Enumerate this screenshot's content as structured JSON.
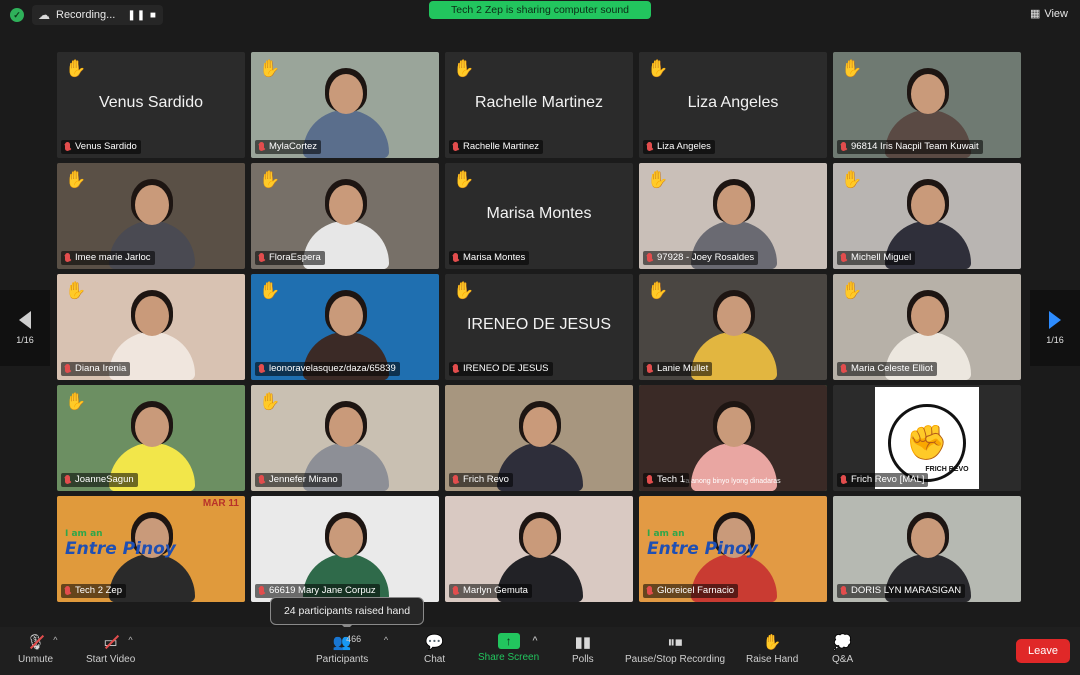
{
  "topbar": {
    "recording_label": "Recording...",
    "recording_controls": "❚❚ ■",
    "share_banner": "Tech 2 Zep is sharing computer sound",
    "view_label": "View"
  },
  "pager": {
    "left": "1/16",
    "right": "1/16"
  },
  "tiles": [
    {
      "name": "Venus Sardido",
      "center": "Venus Sardido",
      "hand": true,
      "video": false
    },
    {
      "name": "MylaCortez",
      "center": "",
      "hand": true,
      "video": true,
      "bg": "#9aa59a",
      "shirt": "#5a6e8c"
    },
    {
      "name": "Rachelle Martinez",
      "center": "Rachelle Martinez",
      "hand": true,
      "video": false
    },
    {
      "name": "Liza Angeles",
      "center": "Liza Angeles",
      "hand": true,
      "video": false
    },
    {
      "name": "96814 Iris Nacpil Team Kuwait",
      "center": "",
      "hand": true,
      "video": true,
      "bg": "#6f7a72",
      "shirt": "#5a4a44"
    },
    {
      "name": "Imee marie Jarloc",
      "center": "",
      "hand": true,
      "video": true,
      "bg": "#5a5046",
      "shirt": "#4a4a52"
    },
    {
      "name": "FloraEspera",
      "center": "",
      "hand": true,
      "video": true,
      "bg": "#777068",
      "shirt": "#e7e7e7"
    },
    {
      "name": "Marisa Montes",
      "center": "Marisa Montes",
      "hand": true,
      "video": false
    },
    {
      "name": "97928 - Joey Rosaldes",
      "center": "",
      "hand": true,
      "video": true,
      "bg": "#c9bfb8",
      "shirt": "#6a6a72"
    },
    {
      "name": "Michell Miguel",
      "center": "",
      "hand": true,
      "video": true,
      "bg": "#b9b5b2",
      "shirt": "#2f2f3a"
    },
    {
      "name": "Diana Irenia",
      "center": "",
      "hand": true,
      "video": true,
      "bg": "#d8c2b2",
      "shirt": "#f0e6de"
    },
    {
      "name": "leonoravelasquez/daza/65839",
      "center": "",
      "hand": true,
      "video": true,
      "bg": "#1f6fb0",
      "shirt": "#3b2a26"
    },
    {
      "name": "IRENEO DE JESUS",
      "center": "IRENEO DE JESUS",
      "hand": true,
      "video": false
    },
    {
      "name": "Lanie Mullet",
      "center": "",
      "hand": true,
      "video": true,
      "bg": "#4a4642",
      "shirt": "#e2b640"
    },
    {
      "name": "Maria Celeste Elliot",
      "center": "",
      "hand": true,
      "video": true,
      "bg": "#b7b1a8",
      "shirt": "#ece7df"
    },
    {
      "name": "JoanneSagun",
      "center": "",
      "hand": true,
      "video": true,
      "bg": "#6c8f62",
      "shirt": "#f2e64a"
    },
    {
      "name": "Jennefer Mirano",
      "center": "",
      "hand": true,
      "video": true,
      "bg": "#c9c0b2",
      "shirt": "#8d8f96"
    },
    {
      "name": "Frich Revo",
      "center": "",
      "hand": false,
      "video": true,
      "bg": "#a7967f",
      "shirt": "#2e2e3a"
    },
    {
      "name": "Tech 1",
      "center": "",
      "hand": false,
      "video": true,
      "bg": "#3a2a26",
      "shirt": "#e9a6a2",
      "caption": "ra anong binyo lyong dinadaras",
      "active": true
    },
    {
      "name": "Frich Revo [MAL]",
      "center": "",
      "hand": false,
      "video": false,
      "logo": true,
      "logo_text": "FRICH REVO"
    },
    {
      "name": "Tech 2 Zep",
      "center": "",
      "hand": false,
      "video": true,
      "bg": "#e09a3c",
      "shirt": "#2a2a2a",
      "banner": "MAR 11",
      "promo_small": "I am an",
      "promo_big": "Entre Pinoy"
    },
    {
      "name": "66619 Mary Jane Corpuz",
      "center": "",
      "hand": false,
      "video": true,
      "bg": "#eaeaea",
      "shirt": "#2f6a4a"
    },
    {
      "name": "Marlyn Gemuta",
      "center": "",
      "hand": false,
      "video": true,
      "bg": "#d9c9c2",
      "shirt": "#222226"
    },
    {
      "name": "Gloreicel Farnacio",
      "center": "",
      "hand": false,
      "video": true,
      "bg": "#e29a44",
      "shirt": "#c93b32",
      "promo_small": "I am an",
      "promo_big": "Entre Pinoy"
    },
    {
      "name": "DORIS LYN MARASIGAN",
      "center": "",
      "hand": false,
      "video": true,
      "bg": "#b6b9b2",
      "shirt": "#2a2a2e"
    }
  ],
  "tooltip": "24 participants raised hand",
  "toolbar": {
    "unmute": "Unmute",
    "start_video": "Start Video",
    "participants": "Participants",
    "participants_count": "466",
    "chat": "Chat",
    "share_screen": "Share Screen",
    "polls": "Polls",
    "pause_recording": "Pause/Stop Recording",
    "raise_hand": "Raise Hand",
    "qa": "Q&A",
    "leave": "Leave"
  },
  "colors": {
    "share_green": "#22c55e",
    "leave_red": "#e02828",
    "active_arrow": "#2d8cff"
  }
}
